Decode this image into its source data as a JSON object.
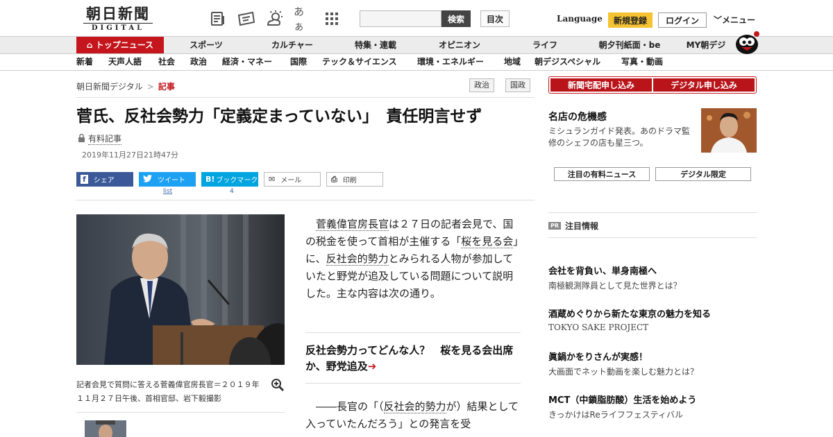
{
  "header": {
    "logo_main": "朝日新聞",
    "logo_sub": "DIGITAL",
    "search_button": "検索",
    "toc_button": "目次",
    "language": "Language",
    "register": "新規登録",
    "login": "ログイン",
    "menu": "メニュー",
    "font_size_icon_label": "あぁ"
  },
  "nav_primary": [
    {
      "label": "トップニュース"
    },
    {
      "label": "スポーツ"
    },
    {
      "label": "カルチャー"
    },
    {
      "label": "特集・連載"
    },
    {
      "label": "オピニオン"
    },
    {
      "label": "ライフ"
    },
    {
      "label": "朝夕刊紙面・be"
    },
    {
      "label": "MY朝デジ"
    }
  ],
  "nav_secondary": [
    {
      "label": "新着"
    },
    {
      "label": "天声人語"
    },
    {
      "label": "社会"
    },
    {
      "label": "政治"
    },
    {
      "label": "経済・マネー"
    },
    {
      "label": "国際"
    },
    {
      "label": "テック＆サイエンス"
    },
    {
      "label": "環境・エネルギー"
    },
    {
      "label": "地域"
    },
    {
      "label": "朝デジスペシャル"
    },
    {
      "label": "写真・動画"
    }
  ],
  "breadcrumb": {
    "home": "朝日新聞デジタル",
    "sep": ">",
    "current": "記事"
  },
  "tags": [
    "政治",
    "国政"
  ],
  "article": {
    "title": "菅氏、反社会勢力「定義定まっていない」　責任明言せず",
    "paid_label": "有料記事",
    "date": "2019年11月27日21時47分",
    "share": {
      "facebook": "シェア",
      "twitter": "ツイート",
      "twitter_count": "list",
      "hatena_icon": "B!",
      "hatena": "ブックマーク",
      "hatena_count": "4",
      "mail": "メール",
      "print": "印刷"
    },
    "photo_caption": "記者会見で質問に答える菅義偉官房長官＝２０１９年１１月２７日午後、首相官邸、岩下毅撮影",
    "p1_a": "菅義偉官房長官",
    "p1_b": "は２７日の記者会見で、国の税金を使って首相が主催する「",
    "p1_c": "桜を見る会",
    "p1_d": "」に、",
    "p1_e": "反社会的勢力",
    "p1_f": "とみられる人物が参加していたと野党が追及している問題について説明した。主な内容は次の通り。",
    "subhead": "反社会勢力ってどんな人？　桜を見る会出席か、野党追及",
    "subhead_arrow": "➔",
    "p2_a": "――長官の「（",
    "p2_b": "反社会的勢力",
    "p2_c": "が）結果として入っていたんだろう」との発言を受"
  },
  "sidebar": {
    "subscribe_paper": "新聞宅配申し込み",
    "subscribe_digital": "デジタル申し込み",
    "feature_title": "名店の危機感",
    "feature_desc": "ミシュランガイド発表。あのドラマ監修のシェフの店も星三つ。",
    "btn_paid_news": "注目の有料ニュース",
    "btn_digital_only": "デジタル限定",
    "pr_badge": "PR",
    "pr_heading": "注目情報",
    "pr_items": [
      {
        "title": "会社を背負い、単身南極へ",
        "sub": "南極観測隊員として見た世界とは？"
      },
      {
        "title": "酒蔵めぐりから新たな東京の魅力を知る",
        "sub": "TOKYO SAKE PROJECT"
      },
      {
        "title": "眞鍋かをりさんが実感！",
        "sub": "大画面でネット動画を楽しむ魅力とは？"
      },
      {
        "title": "MCT（中鎖脂肪酸）生活を始めよう",
        "sub": "きっかけはReライフフェスティバル"
      }
    ]
  },
  "colors": {
    "brand_red": "#c4161c",
    "register_yellow": "#f5c232",
    "facebook": "#3b5998",
    "twitter": "#1da1f2",
    "hatena": "#00a4de"
  }
}
